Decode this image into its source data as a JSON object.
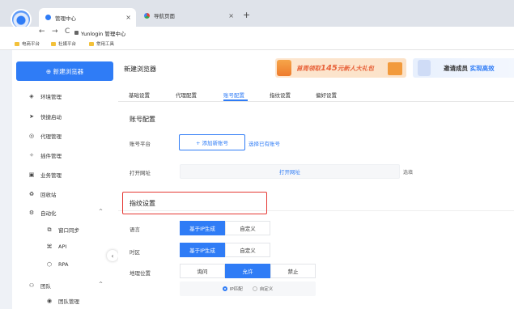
{
  "browser": {
    "tabs": [
      {
        "label": "管理中心"
      },
      {
        "label": "导航页面"
      }
    ],
    "new_tab_symbol": "+",
    "tab_close_symbol": "×",
    "nav": {
      "back": "←",
      "forward": "→",
      "reload": "C"
    },
    "url": "Yunlogin 管理中心",
    "bookmarks": [
      {
        "label": "电商平台"
      },
      {
        "label": "社媒平台"
      },
      {
        "label": "常用工具"
      }
    ]
  },
  "sidebar": {
    "new_browser_button": "⊕  新建浏览器",
    "items": [
      {
        "label": "环境管理",
        "icon": "cube-icon",
        "glyph": "◈"
      },
      {
        "label": "快捷启动",
        "icon": "send-icon",
        "glyph": "➤"
      },
      {
        "label": "代理管理",
        "icon": "globe-icon",
        "glyph": "◎"
      },
      {
        "label": "插件管理",
        "icon": "puzzle-icon",
        "glyph": "✧"
      },
      {
        "label": "业务管理",
        "icon": "briefcase-icon",
        "glyph": "▣"
      },
      {
        "label": "回收站",
        "icon": "recycle-icon",
        "glyph": "♻"
      },
      {
        "label": "自动化",
        "icon": "automation-icon",
        "glyph": "⚙"
      }
    ],
    "automation_sub": [
      {
        "label": "窗口同步",
        "icon": "sync-icon",
        "glyph": "⧉"
      },
      {
        "label": "API",
        "icon": "api-icon",
        "glyph": "⌘"
      },
      {
        "label": "RPA",
        "icon": "rpa-icon",
        "glyph": "⬡"
      }
    ],
    "team": {
      "label": "团队",
      "icon": "team-icon",
      "glyph": "⚇"
    },
    "team_sub": {
      "label": "团队管理"
    },
    "collapse_symbol": "‹",
    "caret_up": "^"
  },
  "main": {
    "page_title": "新建浏览器",
    "banner1": {
      "prefix": "首周领取",
      "amount": "145",
      "suffix": "元新人大礼包"
    },
    "banner2": {
      "prefix": "邀请成员",
      "highlight": "实现高效"
    },
    "tabs": [
      "基础设置",
      "代理配置",
      "账号配置",
      "指纹设置",
      "偏好设置"
    ],
    "active_tab": "账号配置",
    "account_section": {
      "title": "账号配置",
      "platform_label": "账号平台",
      "add_account": "+  添加新账号",
      "select_account": "选择已有账号",
      "open_url_label": "打开网址",
      "open_url_value": "打开网址",
      "open_url_option": "选填"
    },
    "fingerprint_section": {
      "title": "指纹设置",
      "timezone_label": "时区",
      "language_label": "语言",
      "geo_label": "地理位置",
      "tz_options": [
        "基于IP生成",
        "自定义"
      ],
      "lang_options": [
        "基于IP生成",
        "自定义"
      ],
      "geo_options": [
        "询问",
        "允许",
        "禁止"
      ],
      "geo_selected": "允许",
      "geo_sub": [
        "IP匹配",
        "自定义"
      ]
    }
  },
  "colors": {
    "accent": "#2f7cf6",
    "highlight_border": "#e53935",
    "banner_orange": "#e8643c"
  }
}
